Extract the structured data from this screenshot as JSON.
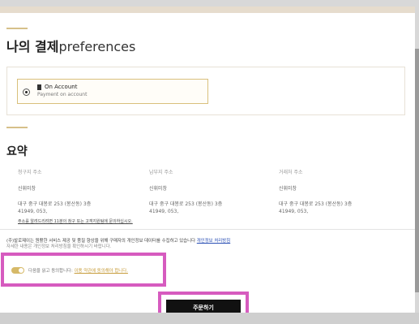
{
  "preferences": {
    "title_bold": "나의 결제",
    "title_light": "preferences"
  },
  "payment": {
    "option_label": "On Account",
    "option_sub": "Payment on account",
    "icon": "card-icon"
  },
  "summary": {
    "title": "요약",
    "columns": [
      {
        "label": "청구지 주소",
        "name": "신휘미창",
        "line1": "대구 중구 대봉로 253 (봉산동) 3층",
        "line2": "41949, 053,"
      },
      {
        "label": "납부지 주소",
        "name": "신휘미창",
        "line1": "대구 중구 대봉로 253 (봉산동) 3층",
        "line2": "41949, 053,"
      },
      {
        "label": "거래처 주소",
        "name": "신휘미창",
        "line1": "대구 중구 대봉로 253 (봉산동) 3층",
        "line2": "41949, 053,"
      }
    ],
    "note_link": "주소를 알려드리려면 11분의 창구 또는 고객지원팀에 문의하십시오."
  },
  "privacy": {
    "text": "(주)발로제이는 원활한 서비스 제공 및 품질 향상을 위해 구매자의 개인정보 데이터를 수집하고 있습니다",
    "link": "개인정보 처리방침",
    "line2": "자세한 내용은 개인정보 처리방침을 확인하시기 바랍니다."
  },
  "consent": {
    "text": "다음을 읽고 동의합니다:",
    "link": "이용 약관에 동의해야 합니다."
  },
  "order": {
    "button_label": "주문하기"
  },
  "colors": {
    "accent_gold": "#d6c08a",
    "highlight_pink": "#d65bbf",
    "button_black": "#111111"
  }
}
